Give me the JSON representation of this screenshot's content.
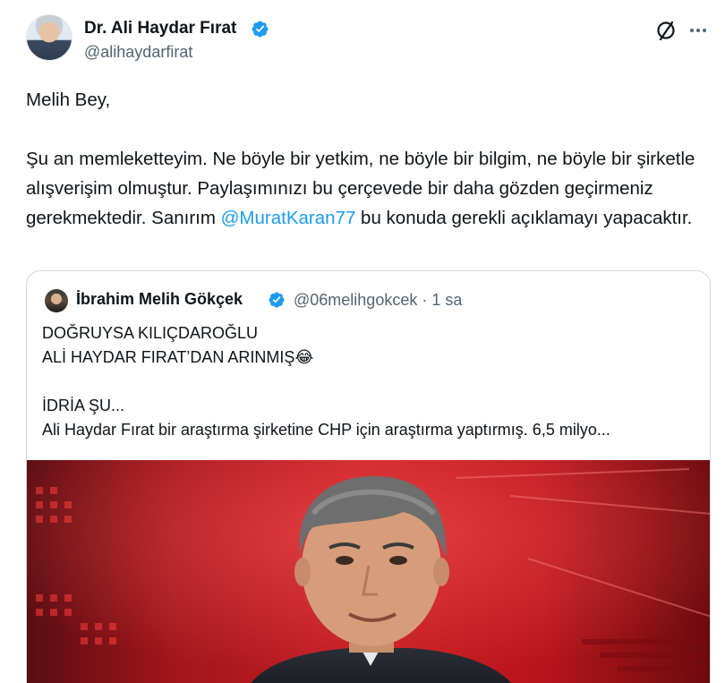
{
  "tweet": {
    "author_name": "Dr. Ali Haydar Fırat",
    "handle": "@alihaydarfirat",
    "body": {
      "greeting": "Melih Bey,",
      "part1": "Şu an memleketteyim. Ne böyle bir yetkim, ne böyle bir bilgim, ne böyle bir şirketle alışverişim olmuştur. Paylaşımınızı bu çerçevede bir daha gözden geçirmeniz gerekmektedir. Sanırım ",
      "mention": "@MuratKaran77",
      "part2": " bu konuda gerekli açıklamayı yapacaktır."
    }
  },
  "quote": {
    "author_name": "İbrahim Melih Gökçek",
    "meta": "@06melihgokcek · 1 sa",
    "lines": [
      "DOĞRUYSA KILIÇDAROĞLU",
      "ALİ HAYDAR FIRAT’DAN ARINMIŞ😂",
      "",
      "İDRİA ŞU...",
      "Ali Haydar Fırat bir araştırma şirketine CHP için araştırma yaptırmış. 6,5 milyo..."
    ]
  },
  "icons": {
    "verified": "verified-badge-icon",
    "grok": "grok-icon",
    "more": "more-options-icon"
  },
  "colors": {
    "accent": "#1d9bf0",
    "text": "#0f1419",
    "secondary": "#536471",
    "border": "#cfd9de"
  }
}
